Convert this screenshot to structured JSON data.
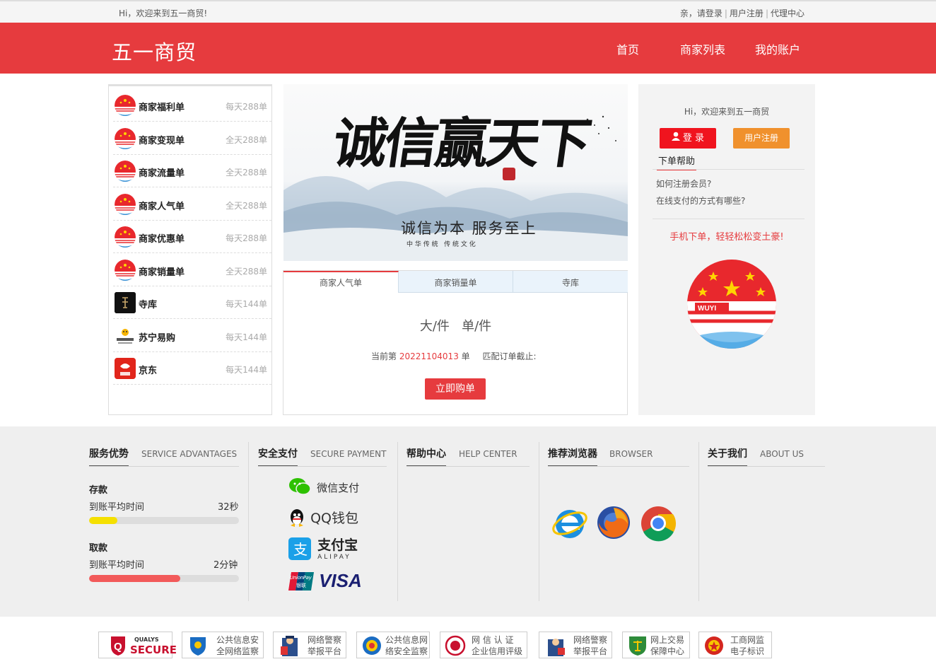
{
  "topbar": {
    "welcome": "Hi，欢迎来到五一商贸!",
    "login": "亲，请登录",
    "register": "用户注册",
    "agent": "代理中心"
  },
  "header": {
    "logo": "五一商贸",
    "nav": [
      "首页",
      "商家列表",
      "我的账户"
    ]
  },
  "leftlist": [
    {
      "name": "商家福利单",
      "count": "每天288单",
      "icon": "wuyi-logo-icon"
    },
    {
      "name": "商家变现单",
      "count": "全天288单",
      "icon": "wuyi-logo-icon"
    },
    {
      "name": "商家流量单",
      "count": "全天288单",
      "icon": "wuyi-logo-icon"
    },
    {
      "name": "商家人气单",
      "count": "全天288单",
      "icon": "wuyi-logo-icon"
    },
    {
      "name": "商家优惠单",
      "count": "每天288单",
      "icon": "wuyi-logo-icon"
    },
    {
      "name": "商家销量单",
      "count": "全天288单",
      "icon": "wuyi-logo-icon"
    },
    {
      "name": "寺库",
      "count": "每天144单",
      "icon": "secoo-icon"
    },
    {
      "name": "苏宁易购",
      "count": "每天144单",
      "icon": "suning-icon"
    },
    {
      "name": "京东",
      "count": "每天144单",
      "icon": "jd-icon"
    }
  ],
  "banner": {
    "title": "诚信赢天下",
    "slogan": "诚信为本 服务至上",
    "sub": "中 华 传 统   传 统 文 化"
  },
  "tabs": [
    "商家人气单",
    "商家销量单",
    "寺库"
  ],
  "order": {
    "units": "大/件   单/件",
    "prefix": "当前第",
    "number": "20221104013",
    "suffix": "单",
    "deadline": "匹配订单截止:",
    "button": "立即购单"
  },
  "right": {
    "welcome": "Hi，欢迎来到五一商贸",
    "login": "登 录",
    "register": "用户注册",
    "help_title": "下单帮助",
    "help": [
      "如何注册会员?",
      "在线支付的方式有哪些?"
    ],
    "promo": "手机下单，轻轻松松变土豪!",
    "logo_text": "WUYI"
  },
  "footer": {
    "cols": [
      {
        "cn": "服务优势",
        "en": "SERVICE ADVANTAGES"
      },
      {
        "cn": "安全支付",
        "en": "SECURE PAYMENT"
      },
      {
        "cn": "帮助中心",
        "en": "HELP CENTER"
      },
      {
        "cn": "推荐浏览器",
        "en": "BROWSER"
      },
      {
        "cn": "关于我们",
        "en": "ABOUT US"
      }
    ],
    "deposit": {
      "title": "存款",
      "label": "到账平均时间",
      "value": "32秒",
      "progress": 0.19,
      "color": "#f5e000"
    },
    "withdraw": {
      "title": "取款",
      "label": "到账平均时间",
      "value": "2分钟",
      "progress": 0.61,
      "color": "#f25a5a"
    },
    "payments": [
      "微信支付",
      "QQ钱包",
      "支付宝",
      "ALIPAY",
      "VISA",
      "UnionPay",
      "银联"
    ]
  },
  "badges": [
    {
      "line1": "QUALYS",
      "line2": "SECURE"
    },
    {
      "line1": "公共信息安",
      "line2": "全网络监察"
    },
    {
      "line1": "网络警察",
      "line2": "举报平台"
    },
    {
      "line1": "公共信息网",
      "line2": "络安全监察"
    },
    {
      "line1": "网 信 认 证",
      "line2": "企业信用评级"
    },
    {
      "line1": "网络警察",
      "line2": "举报平台"
    },
    {
      "line1": "网上交易",
      "line2": "保障中心"
    },
    {
      "line1": "工商网监",
      "line2": "电子标识"
    }
  ]
}
